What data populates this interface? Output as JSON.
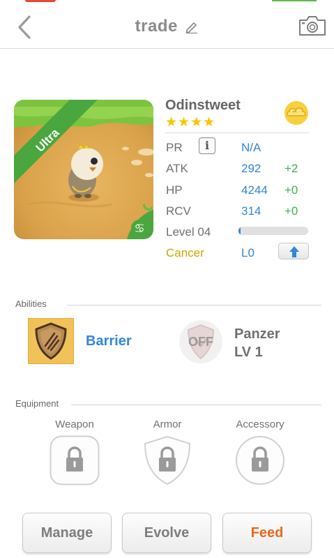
{
  "header": {
    "title": "trade"
  },
  "monster": {
    "rarity": "Ultra",
    "name": "Odinstweet",
    "stars": "★★★★",
    "stats": {
      "pr": {
        "label": "PR",
        "value": "N/A"
      },
      "atk": {
        "label": "ATK",
        "value": "292",
        "bonus": "+2"
      },
      "hp": {
        "label": "HP",
        "value": "4244",
        "bonus": "+0"
      },
      "rcv": {
        "label": "RCV",
        "value": "314",
        "bonus": "+0"
      },
      "level": {
        "label": "Level 04",
        "progress": 0.03
      },
      "sign": {
        "label": "Cancer",
        "value": "L0"
      }
    }
  },
  "abilities": {
    "section_label": "Abilities",
    "items": [
      {
        "name": "Barrier"
      },
      {
        "badge": "OFF",
        "name_line1": "Panzer",
        "name_line2": "LV 1"
      }
    ]
  },
  "equipment": {
    "section_label": "Equipment",
    "slots": [
      {
        "label": "Weapon"
      },
      {
        "label": "Armor"
      },
      {
        "label": "Accessory"
      }
    ]
  },
  "actions": {
    "manage": "Manage",
    "evolve": "Evolve",
    "feed": "Feed"
  },
  "colors": {
    "accent_blue": "#2f87d8",
    "bonus_green": "#3fae4f",
    "feed_orange": "#e56a1e",
    "cancer_gold": "#c9a800",
    "star_yellow": "#f6c600"
  }
}
